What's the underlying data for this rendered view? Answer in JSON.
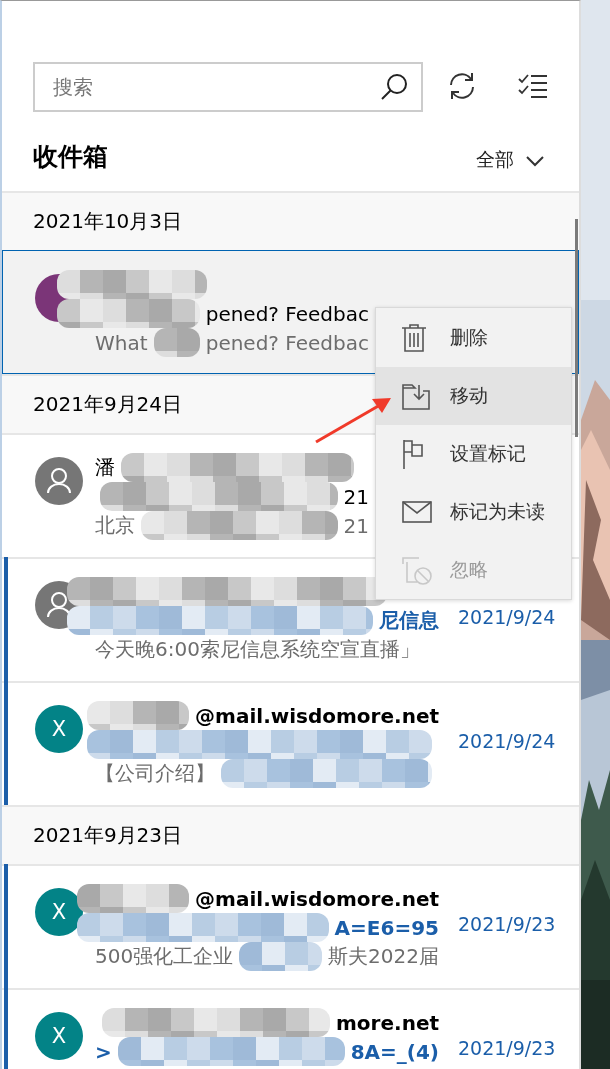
{
  "search": {
    "placeholder": "搜索"
  },
  "folder": {
    "title": "收件箱",
    "filter": "全部"
  },
  "groups": [
    {
      "date": "2021年10月3日",
      "messages": [
        {
          "avatar": {
            "kind": "initial",
            "color": "#7b3578"
          },
          "unread": false,
          "selected": true,
          "subject": {
            "tail": "pened? Feedbac"
          },
          "preview": {
            "head": "What",
            "tail": "pened? Feedbac"
          }
        }
      ]
    },
    {
      "date": "2021年9月24日",
      "messages": [
        {
          "avatar": {
            "kind": "person",
            "color": "#767676"
          },
          "unread": false,
          "selected": false,
          "sender": {
            "head": "潘"
          },
          "subject": {
            "tail": "21"
          },
          "preview": {
            "head": "北京",
            "tail": "21"
          }
        },
        {
          "avatar": {
            "kind": "person",
            "color": "#767676"
          },
          "unread": true,
          "selected": false,
          "subject": {
            "tail": "尼信息"
          },
          "date": "2021/9/24",
          "preview": {
            "head": "今天晚6:00索尼信息系统空宣直播」"
          }
        },
        {
          "avatar": {
            "kind": "initial",
            "letter": "X",
            "color": "#038387"
          },
          "unread": true,
          "selected": false,
          "sender": {
            "tail": "@mail.wisdomore.net"
          },
          "date": "2021/9/24",
          "preview": {
            "head": "【公司介绍】"
          }
        }
      ]
    },
    {
      "date": "2021年9月23日",
      "messages": [
        {
          "avatar": {
            "kind": "initial",
            "letter": "X",
            "color": "#038387"
          },
          "unread": true,
          "selected": false,
          "sender": {
            "tail": "@mail.wisdomore.net"
          },
          "subject": {
            "tail": "A=E6=95"
          },
          "date": "2021/9/23",
          "preview": {
            "head": "500强化工企业",
            "tail": "斯夫2022届"
          }
        },
        {
          "avatar": {
            "kind": "initial",
            "letter": "X",
            "color": "#038387"
          },
          "unread": true,
          "selected": false,
          "sender": {
            "tail": "more.net"
          },
          "subject": {
            "head": ">",
            "tail": "8A=_(4)"
          },
          "date": "2021/9/23"
        }
      ]
    }
  ],
  "context_menu": [
    {
      "kind": "delete",
      "label": "删除",
      "hovered": false,
      "disabled": false
    },
    {
      "kind": "move",
      "label": "移动",
      "hovered": true,
      "disabled": false
    },
    {
      "kind": "flag",
      "label": "设置标记",
      "hovered": false,
      "disabled": false
    },
    {
      "kind": "unread",
      "label": "标记为未读",
      "hovered": false,
      "disabled": false
    },
    {
      "kind": "ignore",
      "label": "忽略",
      "hovered": false,
      "disabled": true
    }
  ]
}
